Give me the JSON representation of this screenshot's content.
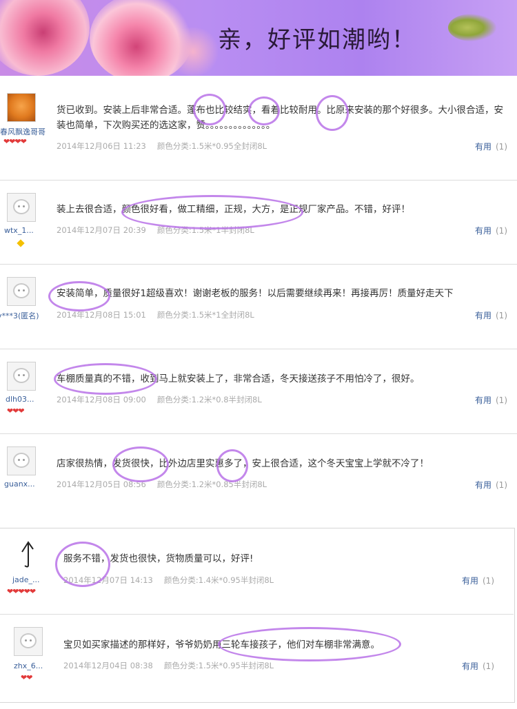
{
  "banner": {
    "title": "亲，好评如潮哟！"
  },
  "reviews": [
    {
      "username": "春风飘逸哥哥",
      "hearts": "❤❤❤❤",
      "comment": "货已收到。安装上后非常合适。蓬布也比较结实，看着比较耐用。比原来安装的那个好很多。大小很合适，安装也简单，下次购买还的选这家，赞。。。。。。。。。。。。。。",
      "date": "2014年12月06日 11:23",
      "category": "颜色分类:1.5米*0.95全封闭8L",
      "useful_label": "有用",
      "useful_count": "(1)"
    },
    {
      "username": "wtx_1...",
      "hearts": "",
      "comment": "装上去很合适，颜色很好看，做工精细，正规，大方，是正规厂家产品。不错，好评！",
      "date": "2014年12月07日 20:39",
      "category": "颜色分类:1.5米*1半封闭8L",
      "useful_label": "有用",
      "useful_count": "(1)"
    },
    {
      "username": "y***3(匿名)",
      "hearts": "",
      "comment": "安装简单，质量很好1超级喜欢！谢谢老板的服务！以后需要继续再来！再接再厉！质量好走天下",
      "date": "2014年12月08日 15:01",
      "category": "颜色分类:1.5米*1全封闭8L",
      "useful_label": "有用",
      "useful_count": "(1)"
    },
    {
      "username": "dlh03...",
      "hearts": "❤❤❤",
      "comment": "车棚质量真的不错，收到马上就安装上了，非常合适，冬天接送孩子不用怕冷了，很好。",
      "date": "2014年12月08日 09:00",
      "category": "颜色分类:1.2米*0.8半封闭8L",
      "useful_label": "有用",
      "useful_count": "(1)"
    },
    {
      "username": "guanx...",
      "hearts": "",
      "comment": "店家很热情，发货很快，比外边店里实惠多了，安上很合适，这个冬天宝宝上学就不冷了！",
      "date": "2014年12月05日 08:56",
      "category": "颜色分类:1.2米*0.85半封闭8L",
      "useful_label": "有用",
      "useful_count": "(1)"
    },
    {
      "username": "jade_...",
      "hearts": "❤❤❤❤❤",
      "comment": "服务不错，发货也很快，货物质量可以，好评!",
      "date": "2014年12月07日 14:13",
      "category": "颜色分类:1.4米*0.95半封闭8L",
      "useful_label": "有用",
      "useful_count": "(1)"
    },
    {
      "username": "zhx_6...",
      "hearts": "❤❤",
      "comment": "宝贝如买家描述的那样好，爷爷奶奶用三轮车接孩子，他们对车棚非常满意。",
      "date": "2014年12月04日 08:38",
      "category": "颜色分类:1.5米*0.95半封闭8L",
      "useful_label": "有用",
      "useful_count": "(1)"
    }
  ],
  "colors": {
    "highlight": "#b872e8",
    "banner": "#b98ef2",
    "link": "#3a5f9a"
  }
}
